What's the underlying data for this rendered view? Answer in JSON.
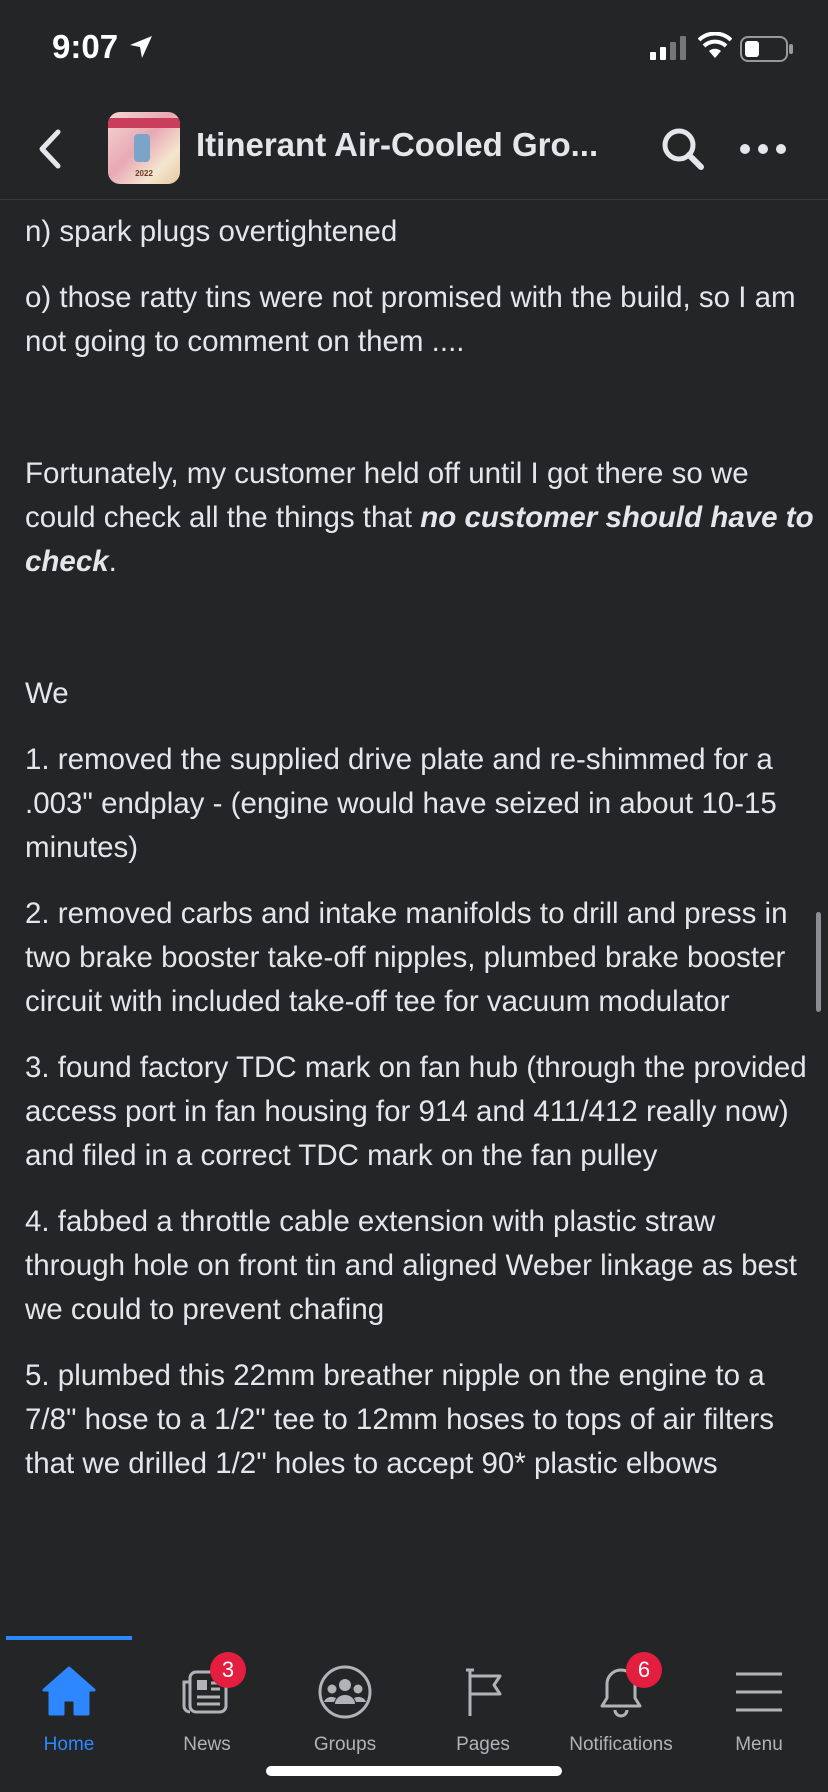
{
  "status_bar": {
    "time": "9:07"
  },
  "header": {
    "title": "Itinerant Air-Cooled Gro...",
    "avatar_caption": "2022"
  },
  "post": {
    "p_n": "n) spark plugs overtightened",
    "p_o": "o) those ratty tins were not promised with the build, so I am not going to comment on them ....",
    "fortunately_text": "Fortunately, my customer held off until I got there so we could check all the things that ",
    "fortunately_bold": "no customer should have to check",
    "fortunately_end": ".",
    "we": "We",
    "items": [
      "1. removed the supplied drive plate and re-shimmed for a .003\" endplay - (engine would have seized in about 10-15 minutes)",
      "2. removed carbs and intake manifolds to drill and press in two brake booster take-off nipples, plumbed brake booster circuit with included take-off tee for vacuum modulator",
      "3. found factory TDC mark on fan hub (through the provided access port in fan housing for 914 and 411/412 really now) and filed in a correct TDC mark on the fan pulley",
      "4. fabbed a throttle cable extension with plastic straw through hole on front tin and aligned Weber linkage as best we could to prevent chafing",
      "5. plumbed this 22mm breather nipple on the engine to a 7/8\" hose to a 1/2\" tee to 12mm hoses to tops of air filters that we drilled 1/2\" holes to accept  90* plastic elbows"
    ]
  },
  "tabs": [
    {
      "label": "Home",
      "icon": "home-icon",
      "active": true
    },
    {
      "label": "News",
      "icon": "news-icon",
      "badge": "3"
    },
    {
      "label": "Groups",
      "icon": "groups-icon"
    },
    {
      "label": "Pages",
      "icon": "pages-flag-icon"
    },
    {
      "label": "Notifications",
      "icon": "bell-icon",
      "badge": "6"
    },
    {
      "label": "Menu",
      "icon": "menu-icon"
    }
  ],
  "colors": {
    "background": "#242526",
    "text": "#e4e6eb",
    "accent": "#2d88ff",
    "badge": "#e41e3f",
    "muted": "#b0b3b8"
  }
}
